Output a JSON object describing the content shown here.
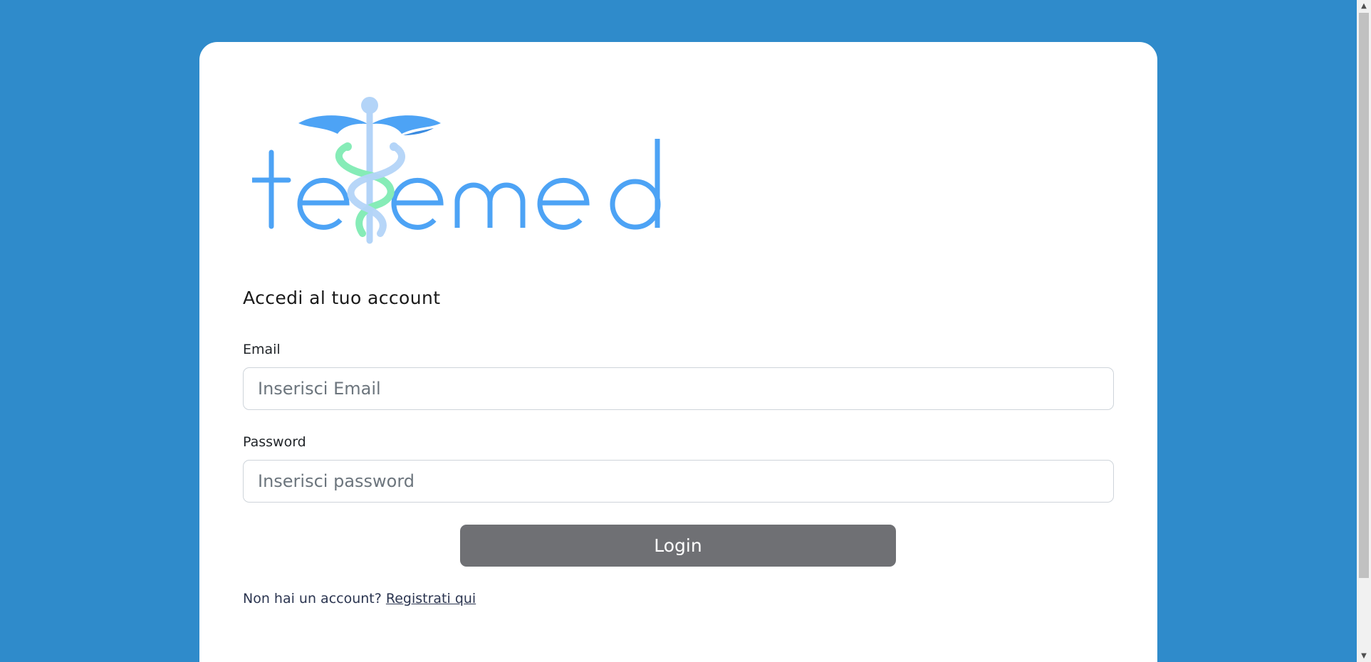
{
  "logo": {
    "text": "telemed",
    "alt": "telemed logo"
  },
  "login": {
    "heading": "Accedi al tuo account",
    "email_label": "Email",
    "email_placeholder": "Inserisci Email",
    "email_value": "",
    "password_label": "Password",
    "password_placeholder": "Inserisci password",
    "password_value": "",
    "button_label": "Login",
    "register_prompt": "Non hai un account?",
    "register_link": "Registrati qui"
  },
  "colors": {
    "background": "#2f8bcb",
    "logo_blue": "#4da3f5",
    "logo_green": "#86ecb7",
    "button": "#6f7074"
  },
  "icons": {
    "logo_symbol": "caduceus-icon",
    "scroll_up": "scroll-up-arrow-icon",
    "scroll_down": "scroll-down-arrow-icon"
  }
}
